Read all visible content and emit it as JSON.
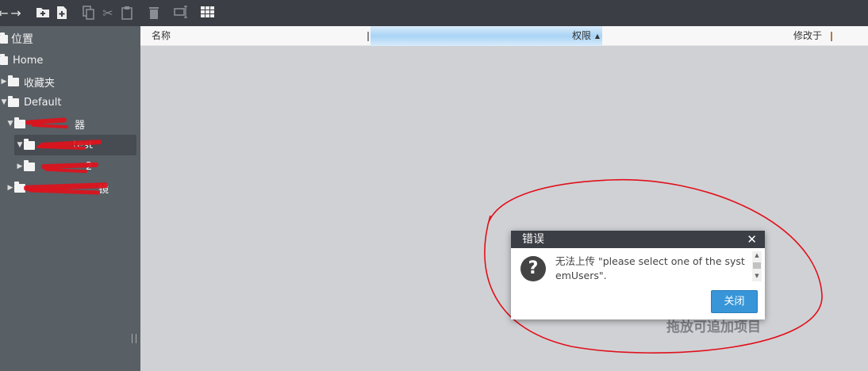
{
  "toolbar": {
    "icons": [
      "back-icon",
      "forward-icon",
      "new-folder-icon",
      "new-file-icon",
      "copy-icon",
      "cut-icon",
      "paste-icon",
      "delete-icon",
      "rename-icon",
      "grid-view-icon"
    ]
  },
  "sidebar": {
    "root_label": "位置",
    "items": [
      {
        "label": "Home"
      },
      {
        "label": "收藏夹"
      },
      {
        "label": "Default"
      },
      {
        "label": "器"
      },
      {
        "label": "test"
      },
      {
        "label": "2"
      },
      {
        "label": "镜"
      }
    ]
  },
  "columns": {
    "name": "名称",
    "permission": "权限",
    "modified": "修改于"
  },
  "empty_hint": "拖放可追加项目",
  "dialog": {
    "title": "错误",
    "message": "无法上传 \"please select one of the systemUsers\".",
    "close_button": "关闭"
  },
  "colors": {
    "toolbar_bg": "#3b3e44",
    "sidebar_bg": "#585f65",
    "accent": "#3795d8",
    "annotation": "#e0111b"
  }
}
